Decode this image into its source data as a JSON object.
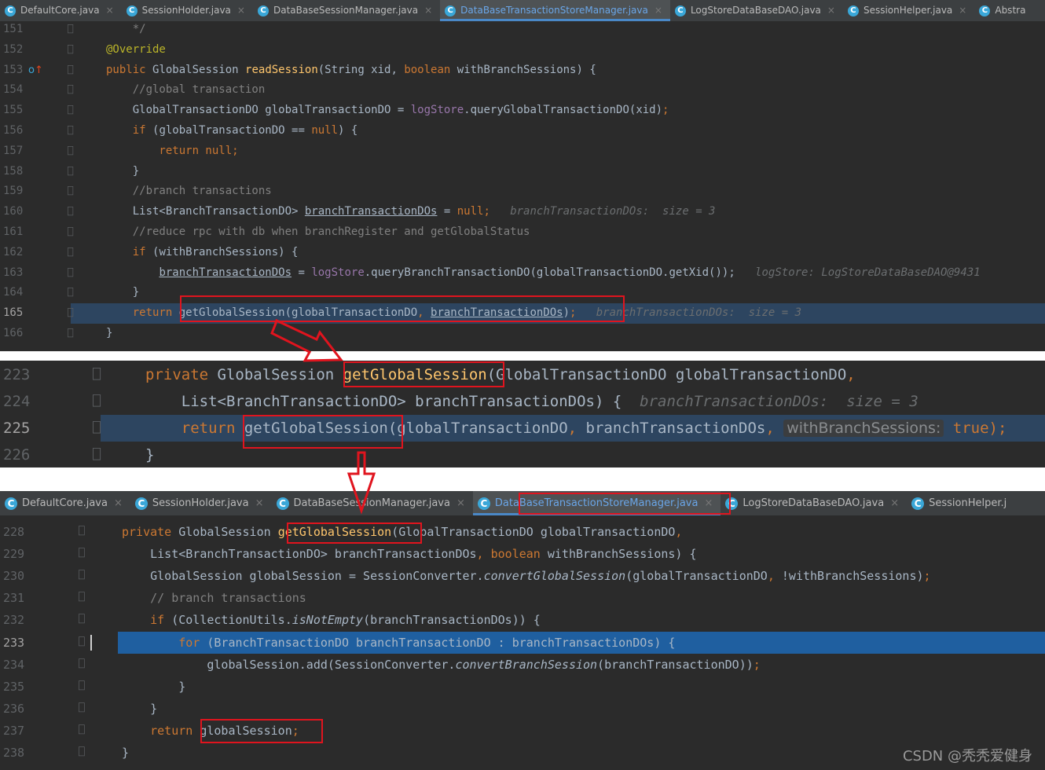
{
  "panel1": {
    "tabs": [
      {
        "name": "DefaultCore.java",
        "active": false
      },
      {
        "name": "SessionHolder.java",
        "active": false
      },
      {
        "name": "DataBaseSessionManager.java",
        "active": false
      },
      {
        "name": "DataBaseTransactionStoreManager.java",
        "active": true
      },
      {
        "name": "LogStoreDataBaseDAO.java",
        "active": false
      },
      {
        "name": "SessionHelper.java",
        "active": false
      },
      {
        "name": "Abstra",
        "active": false
      }
    ],
    "lines": [
      {
        "n": "151",
        "segs": [
          [
            "cm",
            "    */"
          ]
        ]
      },
      {
        "n": "152",
        "segs": [
          [
            "ann",
            "@Override"
          ]
        ]
      },
      {
        "n": "153",
        "segs": [
          [
            "kw",
            "public "
          ],
          [
            "",
            "GlobalSession "
          ],
          [
            "fn",
            "readSession"
          ],
          [
            "",
            "(String xid, "
          ],
          [
            "kw",
            "boolean "
          ],
          [
            "",
            "withBranchSessions) {"
          ]
        ]
      },
      {
        "n": "154",
        "segs": [
          [
            "cm",
            "    //global transaction"
          ]
        ]
      },
      {
        "n": "155",
        "segs": [
          [
            "",
            "    GlobalTransactionDO globalTransactionDO = "
          ],
          [
            "fld",
            "logStore"
          ],
          [
            "",
            ".queryGlobalTransactionDO(xid)"
          ],
          [
            "kw",
            ";"
          ]
        ]
      },
      {
        "n": "156",
        "segs": [
          [
            "kw",
            "    if "
          ],
          [
            "",
            "(globalTransactionDO == "
          ],
          [
            "kw",
            "null"
          ],
          [
            "",
            ") {"
          ]
        ]
      },
      {
        "n": "157",
        "segs": [
          [
            "kw",
            "        return null;"
          ]
        ]
      },
      {
        "n": "158",
        "segs": [
          [
            "",
            "    }"
          ]
        ]
      },
      {
        "n": "159",
        "segs": [
          [
            "cm",
            "    //branch transactions"
          ]
        ]
      },
      {
        "n": "160",
        "segs": [
          [
            "",
            "    List<BranchTransactionDO> "
          ],
          [
            "ul",
            "branchTransactionDOs"
          ],
          [
            "",
            " = "
          ],
          [
            "kw",
            "null;"
          ],
          [
            "hint",
            "   branchTransactionDOs:  size = 3"
          ]
        ]
      },
      {
        "n": "161",
        "segs": [
          [
            "cm",
            "    //reduce rpc with db when branchRegister and getGlobalStatus"
          ]
        ]
      },
      {
        "n": "162",
        "segs": [
          [
            "kw",
            "    if "
          ],
          [
            "",
            "(withBranchSessions) {"
          ]
        ]
      },
      {
        "n": "163",
        "segs": [
          [
            "",
            "        "
          ],
          [
            "ul",
            "branchTransactionDOs"
          ],
          [
            "",
            " = "
          ],
          [
            "fld",
            "logStore"
          ],
          [
            "",
            ".queryBranchTransactionDO(globalTransactionDO.getXid());"
          ],
          [
            "hint",
            "   logStore: LogStoreDataBaseDAO@9431"
          ]
        ]
      },
      {
        "n": "164",
        "segs": [
          [
            "",
            "    }"
          ]
        ]
      },
      {
        "n": "165",
        "segs": [
          [
            "kw",
            "    return "
          ],
          [
            "",
            "getGlobalSession(globalTransactionDO"
          ],
          [
            "kw",
            ", "
          ],
          [
            "ul",
            "branchTransactionDOs"
          ],
          [
            "",
            ")"
          ],
          [
            "kw",
            ";"
          ],
          [
            "hint",
            "   branchTransactionDOs:  size = 3"
          ]
        ]
      },
      {
        "n": "166",
        "segs": [
          [
            "",
            "}"
          ]
        ]
      }
    ]
  },
  "panel2": {
    "lines": [
      {
        "n": "223",
        "segs": [
          [
            "kw",
            "private "
          ],
          [
            "",
            "GlobalSession "
          ],
          [
            "fn",
            "getGlobalSession"
          ],
          [
            "",
            "(GlobalTransactionDO globalTransactionDO"
          ],
          [
            "kw",
            ","
          ]
        ]
      },
      {
        "n": "224",
        "segs": [
          [
            "",
            "    List<BranchTransactionDO> branchTransactionDOs) {"
          ],
          [
            "hint",
            "  branchTransactionDOs:  size = 3"
          ]
        ]
      },
      {
        "n": "225",
        "segs": [
          [
            "kw",
            "    return "
          ],
          [
            "",
            "getGlobalSession(globalTransactionDO"
          ],
          [
            "kw",
            ", "
          ],
          [
            "",
            "branchTransactionDOs"
          ],
          [
            "kw",
            ", "
          ],
          [
            "chip",
            "withBranchSessions:"
          ],
          [
            "kw",
            " true);"
          ]
        ]
      },
      {
        "n": "226",
        "segs": [
          [
            "",
            "}"
          ]
        ]
      }
    ]
  },
  "panel3": {
    "tabs": [
      {
        "name": "DefaultCore.java",
        "active": false
      },
      {
        "name": "SessionHolder.java",
        "active": false
      },
      {
        "name": "DataBaseSessionManager.java",
        "active": false
      },
      {
        "name": "DataBaseTransactionStoreManager.java",
        "active": true
      },
      {
        "name": "LogStoreDataBaseDAO.java",
        "active": false
      },
      {
        "name": "SessionHelper.j",
        "active": false
      }
    ],
    "lines": [
      {
        "n": "228",
        "segs": [
          [
            "kw",
            "private "
          ],
          [
            "",
            "GlobalSession "
          ],
          [
            "fn",
            "getGlobalSession"
          ],
          [
            "",
            "(GlobalTransactionDO globalTransactionDO"
          ],
          [
            "kw",
            ","
          ]
        ]
      },
      {
        "n": "229",
        "segs": [
          [
            "",
            "    List<BranchTransactionDO> branchTransactionDOs"
          ],
          [
            "kw",
            ", boolean "
          ],
          [
            "",
            "withBranchSessions) {"
          ]
        ]
      },
      {
        "n": "230",
        "segs": [
          [
            "",
            "    GlobalSession globalSession = SessionConverter."
          ],
          [
            "it",
            "convertGlobalSession"
          ],
          [
            "",
            "(globalTransactionDO"
          ],
          [
            "kw",
            ", "
          ],
          [
            "",
            "!withBranchSessions)"
          ],
          [
            "kw",
            ";"
          ]
        ]
      },
      {
        "n": "231",
        "segs": [
          [
            "cm",
            "    // branch transactions"
          ]
        ]
      },
      {
        "n": "232",
        "segs": [
          [
            "kw",
            "    if "
          ],
          [
            "",
            "(CollectionUtils."
          ],
          [
            "it",
            "isNotEmpty"
          ],
          [
            "",
            "(branchTransactionDOs)) {"
          ]
        ]
      },
      {
        "n": "233",
        "segs": [
          [
            "kw",
            "        for "
          ],
          [
            "",
            "(BranchTransactionDO branchTransactionDO : branchTransactionDOs) {"
          ]
        ]
      },
      {
        "n": "234",
        "segs": [
          [
            "",
            "            globalSession.add(SessionConverter."
          ],
          [
            "it",
            "convertBranchSession"
          ],
          [
            "",
            "(branchTransactionDO))"
          ],
          [
            "kw",
            ";"
          ]
        ]
      },
      {
        "n": "235",
        "segs": [
          [
            "",
            "        }"
          ]
        ]
      },
      {
        "n": "236",
        "segs": [
          [
            "",
            "    }"
          ]
        ]
      },
      {
        "n": "237",
        "segs": [
          [
            "kw",
            "    return "
          ],
          [
            "",
            "globalSession"
          ],
          [
            "kw",
            ";"
          ]
        ]
      },
      {
        "n": "238",
        "segs": [
          [
            "",
            "}"
          ]
        ]
      }
    ]
  },
  "watermark": "CSDN @秃秃爱健身"
}
